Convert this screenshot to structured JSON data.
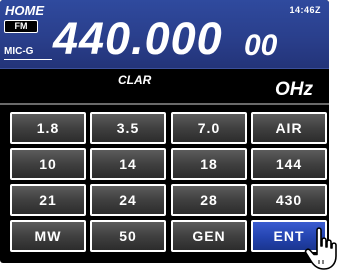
{
  "status": {
    "home": "HOME",
    "time": "14:46Z"
  },
  "mode": "FM",
  "mic": "MIC-G",
  "frequency": {
    "main": "440.000",
    "sub": "00"
  },
  "clarifier": {
    "label": "CLAR",
    "value": "OHz"
  },
  "keypad": [
    "1.8",
    "3.5",
    "7.0",
    "AIR",
    "10",
    "14",
    "18",
    "144",
    "21",
    "24",
    "28",
    "430",
    "MW",
    "50",
    "GEN",
    "ENT"
  ],
  "colors": {
    "frequency_panel": "#2a3f8c",
    "active_key": "#2444b0",
    "key": "#404040"
  },
  "icons": {
    "cursor": "hand-pointer-icon"
  }
}
